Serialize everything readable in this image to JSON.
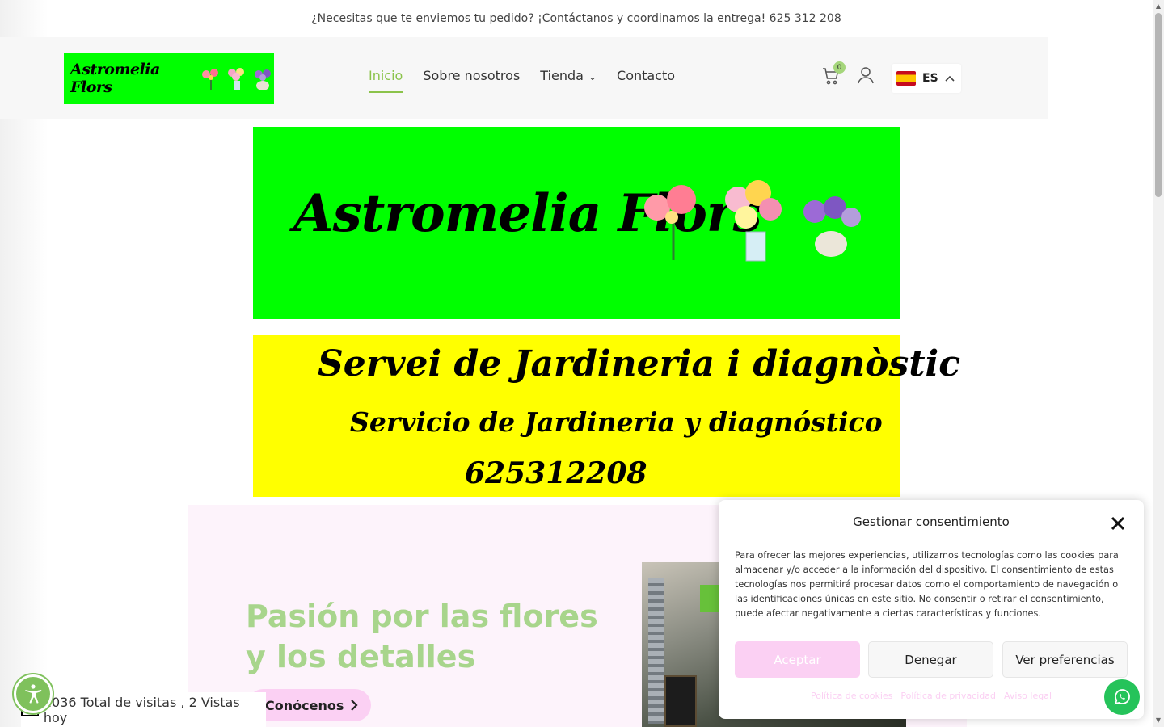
{
  "topbar": {
    "text": "¿Necesitas que te enviemos tu pedido? ¡Contáctanos y coordinamos la entrega! 625 312 208"
  },
  "header": {
    "logo_text": "Astromelia Flors",
    "nav": [
      {
        "label": "Inicio",
        "active": true
      },
      {
        "label": "Sobre nosotros",
        "active": false
      },
      {
        "label": "Tienda",
        "active": false,
        "has_dropdown": true
      },
      {
        "label": "Contacto",
        "active": false
      }
    ],
    "cart_count": "0",
    "language": {
      "code": "ES",
      "flag": "spain-flag-icon"
    }
  },
  "banners": {
    "green": {
      "text": "Astromelia Flors",
      "color": "#00ff00"
    },
    "yellow": {
      "line1": "Servei de Jardineria i diagnòstic",
      "line2": "Servicio de Jardineria y diagnóstico",
      "line3": "625312208",
      "color": "#ffff00"
    }
  },
  "hero": {
    "title": "Pasión por las flores y los detalles",
    "button": "Conócenos",
    "title_color": "#a8d58c",
    "bg_color": "#fdf3fb"
  },
  "visits": {
    "text": "2036 Total de visitas , 2 Vistas hoy"
  },
  "consent": {
    "title": "Gestionar consentimiento",
    "body": "Para ofrecer las mejores experiencias, utilizamos tecnologías como las cookies para almacenar y/o acceder a la información del dispositivo. El consentimiento de estas tecnologías nos permitirá procesar datos como el comportamiento de navegación o las identificaciones únicas en este sitio. No consentir o retirar el consentimiento, puede afectar negativamente a ciertas características y funciones.",
    "accept": "Aceptar",
    "deny": "Denegar",
    "preferences": "Ver preferencias",
    "links": [
      "Política de cookies",
      "Política de privacidad",
      "Aviso legal"
    ],
    "accent": "#fbd0f3"
  }
}
